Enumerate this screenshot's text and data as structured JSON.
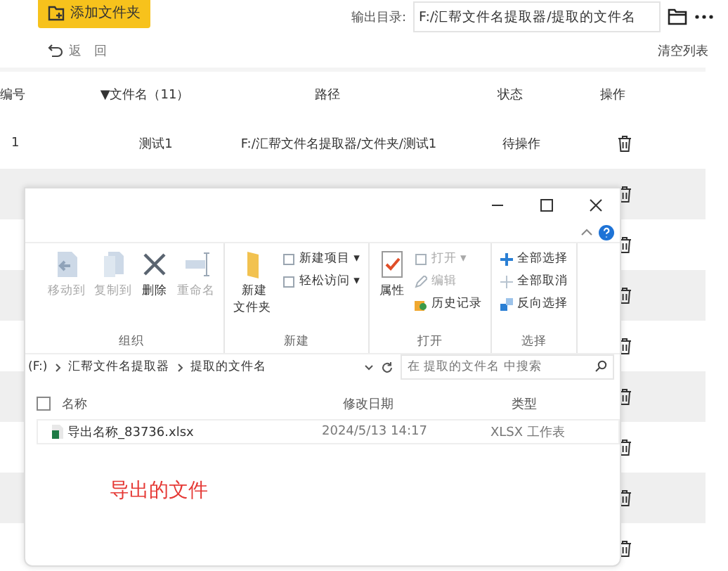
{
  "toolbar": {
    "add_button": "添加文件夹",
    "output_label": "输出目录:",
    "output_path": "F:/汇帮文件名提取器/提取的文件名",
    "back": "返　回",
    "clear": "清空列表"
  },
  "table": {
    "columns": [
      "编号",
      "▼文件名（11）",
      "路径",
      "状态",
      "操作"
    ],
    "rows": [
      {
        "kind": "full",
        "cells": [
          "1",
          "测试1",
          "F:/汇帮文件名提取器/文件夹/测试1",
          "待操作"
        ]
      },
      {
        "kind": "covered"
      },
      {
        "kind": "covered"
      },
      {
        "kind": "covered"
      },
      {
        "kind": "covered"
      },
      {
        "kind": "covered"
      },
      {
        "kind": "covered"
      },
      {
        "kind": "covered"
      },
      {
        "kind": "covered"
      }
    ]
  },
  "explorer": {
    "ribbon": [
      {
        "name": "组织",
        "items": [
          {
            "label": "移动到",
            "kind": "large",
            "disabled": true
          },
          {
            "label": "复制到",
            "kind": "large",
            "disabled": true
          },
          {
            "label": "删除",
            "kind": "large",
            "disabled": false
          },
          {
            "label": "重命名",
            "kind": "large",
            "disabled": true
          }
        ]
      },
      {
        "name": "新建",
        "items": [
          {
            "label": "新建文件夹",
            "kind": "large",
            "disabled": false
          },
          {
            "label": "新建项目 ▾",
            "kind": "small",
            "disabled": false
          },
          {
            "label": "轻松访问 ▾",
            "kind": "small",
            "disabled": false
          }
        ]
      },
      {
        "name": "打开",
        "items": [
          {
            "label": "属性",
            "kind": "large",
            "disabled": false
          },
          {
            "label": "打开 ▾",
            "kind": "small",
            "disabled": true
          },
          {
            "label": "编辑",
            "kind": "small",
            "disabled": true
          },
          {
            "label": "历史记录",
            "kind": "small",
            "disabled": false
          }
        ]
      },
      {
        "name": "选择",
        "items": [
          {
            "label": "全部选择",
            "kind": "small",
            "disabled": false
          },
          {
            "label": "全部取消",
            "kind": "small",
            "disabled": false
          },
          {
            "label": "反向选择",
            "kind": "small",
            "disabled": false
          }
        ]
      }
    ],
    "breadcrumb": [
      "(F:)",
      "汇帮文件名提取器",
      "提取的文件名"
    ],
    "search_placeholder": "在 提取的文件名 中搜索",
    "select_all_checked": false,
    "columns": [
      "名称",
      "修改日期",
      "类型"
    ],
    "files": [
      {
        "name": "导出名称_83736.xlsx",
        "modified": "2024/5/13 14:17",
        "type": "XLSX 工作表"
      }
    ],
    "annotation": "导出的文件"
  }
}
